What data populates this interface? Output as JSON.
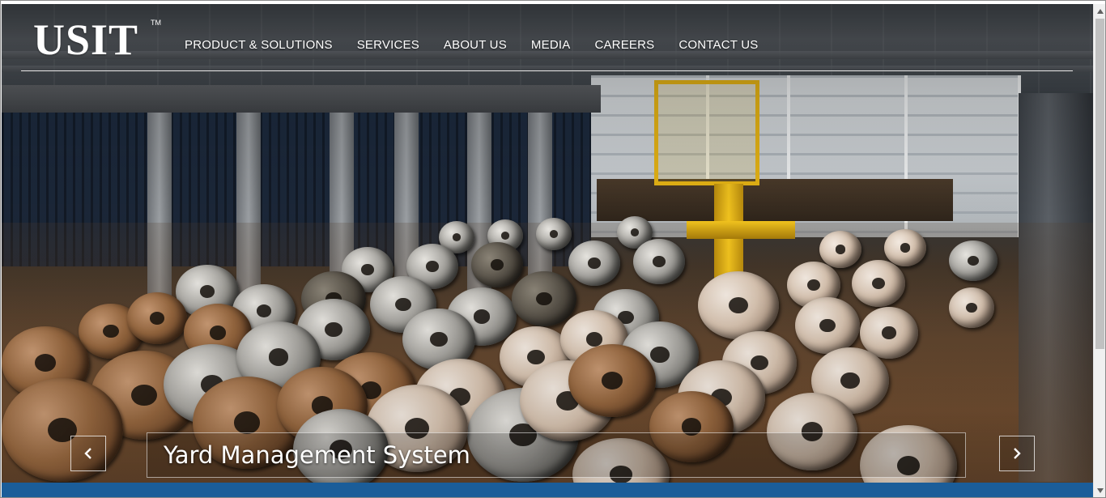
{
  "header": {
    "logo_text": "USIT",
    "logo_tm": "TM",
    "nav": [
      {
        "label": "PRODUCT & SOLUTIONS"
      },
      {
        "label": "SERVICES"
      },
      {
        "label": "ABOUT US"
      },
      {
        "label": "MEDIA"
      },
      {
        "label": "CAREERS"
      },
      {
        "label": "CONTACT US"
      }
    ]
  },
  "slider": {
    "caption": "Yard Management System",
    "prev_icon": "chevron-left-icon",
    "next_icon": "chevron-right-icon"
  },
  "colors": {
    "bottom_bar": "#1b5d99",
    "crane_yellow": "#e5b315",
    "nav_text": "#ffffff"
  }
}
